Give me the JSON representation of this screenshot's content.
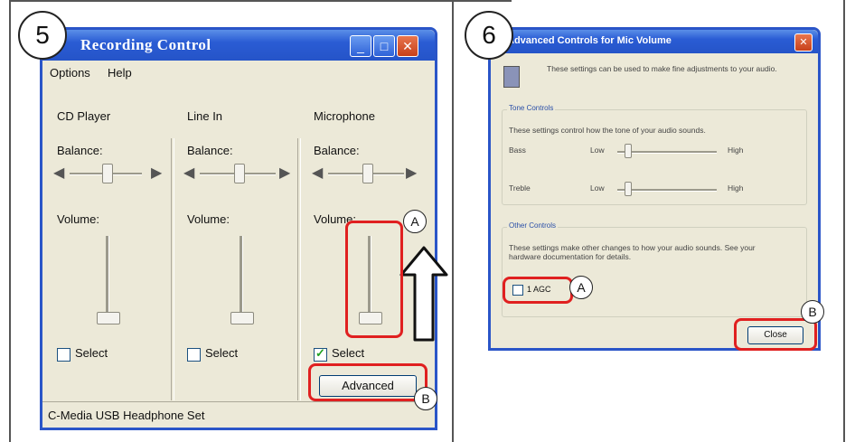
{
  "step5": {
    "step_number": "5",
    "window_title": "Recording Control",
    "menu": [
      "Options",
      "Help"
    ],
    "columns": [
      {
        "label": "CD Player",
        "balance_label": "Balance:",
        "volume_label": "Volume:",
        "select_label": "Select",
        "selected": false
      },
      {
        "label": "Line In",
        "balance_label": "Balance:",
        "volume_label": "Volume:",
        "select_label": "Select",
        "selected": false
      },
      {
        "label": "Microphone",
        "balance_label": "Balance:",
        "volume_label": "Volume:",
        "select_label": "Select",
        "selected": true
      }
    ],
    "advanced_label": "Advanced",
    "status_text": "C-Media USB Headphone Set",
    "callout_a": "A",
    "callout_b": "B"
  },
  "step6": {
    "step_number": "6",
    "window_title": "Advanced Controls for Mic Volume",
    "intro_text": "These settings can be used to make fine adjustments to your audio.",
    "tone_group_title": "Tone Controls",
    "tone_desc": "These settings control how the tone of your audio sounds.",
    "bass_label": "Bass",
    "treble_label": "Treble",
    "low_label": "Low",
    "high_label": "High",
    "other_group_title": "Other Controls",
    "other_desc": "These settings make other changes to how your audio sounds. See your hardware documentation for details.",
    "agc_label": "1 AGC",
    "close_label": "Close",
    "callout_a": "A",
    "callout_b": "B"
  },
  "colors": {
    "highlight": "#e02020",
    "xp_blue": "#2a55c8",
    "xp_face": "#ece9d8"
  }
}
